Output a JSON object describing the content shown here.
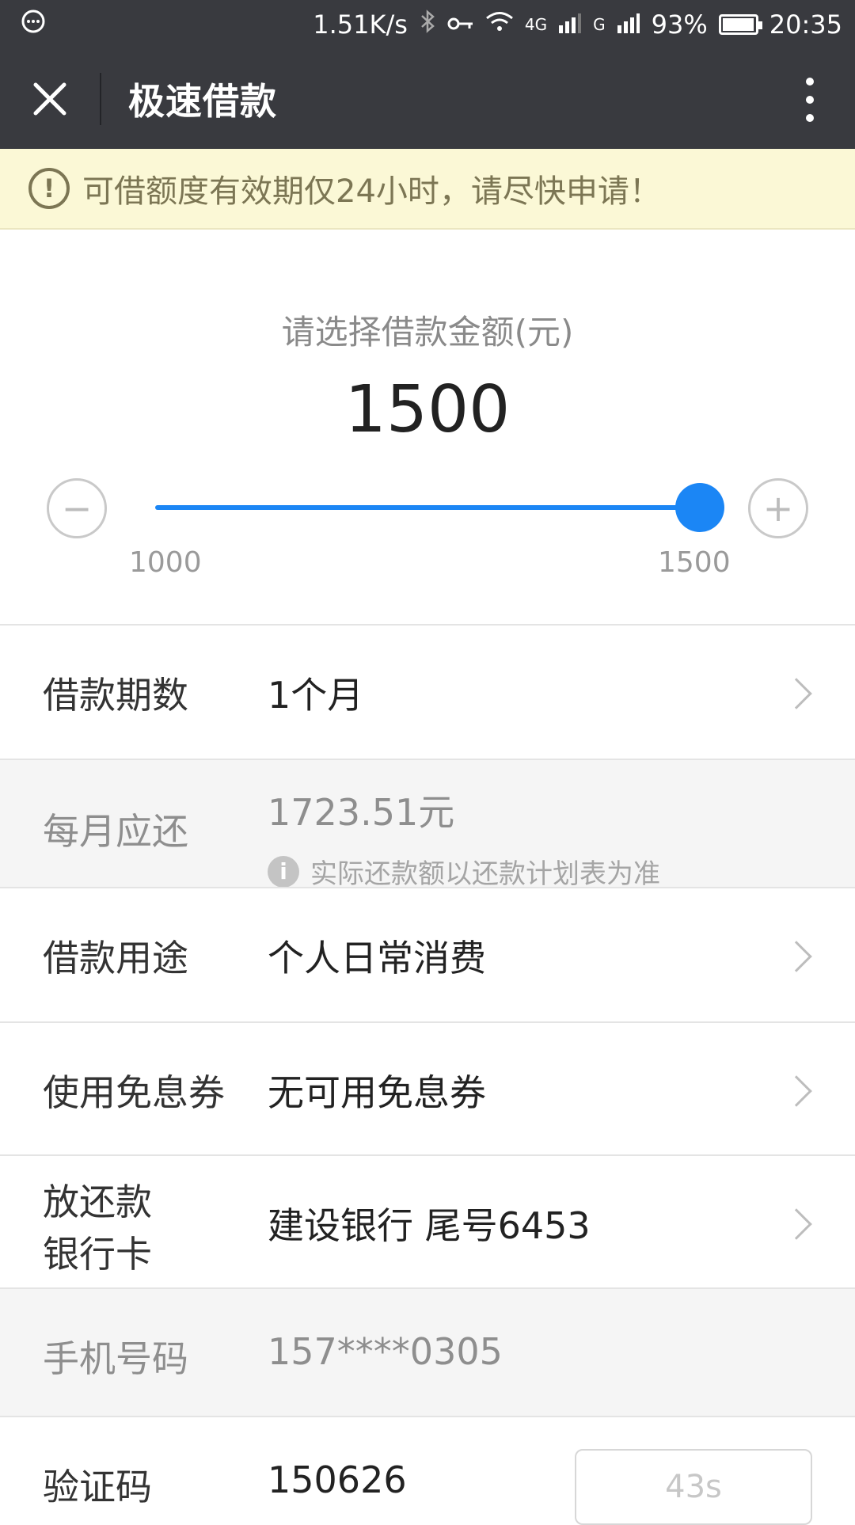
{
  "status_bar": {
    "speed": "1.51K/s",
    "network_4g": "4G",
    "network_g": "G",
    "battery": "93%",
    "time": "20:35"
  },
  "title_bar": {
    "title": "极速借款"
  },
  "notice": {
    "icon": "!",
    "text": "可借额度有效期仅24小时，请尽快申请！"
  },
  "amount": {
    "label": "请选择借款金额(元)",
    "value": "1500",
    "min": "1000",
    "max": "1500",
    "slider_level": 1.0,
    "minus_glyph": "−",
    "plus_glyph": "+"
  },
  "rows": {
    "term": {
      "label": "借款期数",
      "value": "1个月"
    },
    "monthly": {
      "label": "每月应还",
      "value": "1723.51元",
      "note": "实际还款额以还款计划表为准",
      "note_icon": "i"
    },
    "purpose": {
      "label": "借款用途",
      "value": "个人日常消费"
    },
    "coupon": {
      "label": "使用免息券",
      "value": "无可用免息券"
    },
    "bank": {
      "label_line1": "放还款",
      "label_line2": "银行卡",
      "value": "建设银行 尾号6453"
    },
    "phone": {
      "label": "手机号码",
      "value": "157****0305"
    },
    "code": {
      "label": "验证码",
      "value": "150626",
      "countdown": "43s"
    }
  },
  "colors": {
    "header_bg": "#393a3f",
    "accent_blue": "#1b86f5",
    "notice_bg": "#fbf8d6"
  }
}
